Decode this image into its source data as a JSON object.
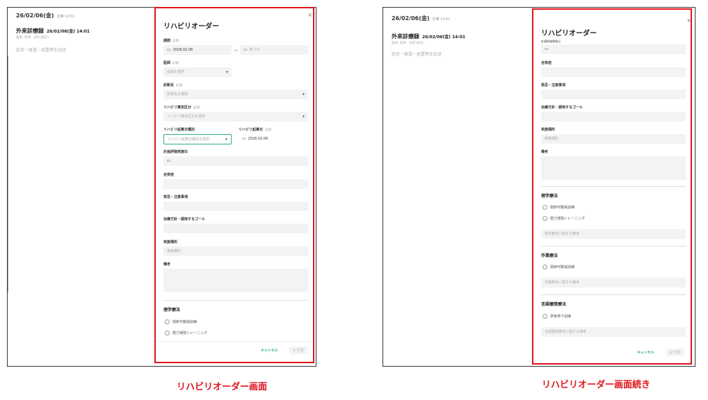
{
  "background": {
    "date_header": "26/02/06(金)",
    "date_sub": "診察 14:01",
    "record_title": "外来診療録",
    "record_datetime": "26/02/06(金) 14:01",
    "record_meta": "医師: 若林　初診(再診)",
    "note_placeholder": "症状・経過・処置等を記述"
  },
  "modal": {
    "title": "リハビリオーダー",
    "close": "×",
    "required": "必須",
    "period_label": "期間",
    "period_start": "2026.02.06",
    "period_tilde": "〜",
    "period_end_placeholder": "終了日",
    "doctor_label": "医師",
    "doctor_placeholder": "医師を選択",
    "diagnosis_label": "診断名",
    "diagnosis_placeholder": "診断名を選択",
    "calc_label": "リハビリ算定区分",
    "calc_placeholder": "リハビリ算定区分を選択",
    "start_type_label": "リハビリ起算日種別",
    "start_type_placeholder": "リハビリ起算日種別を選択",
    "start_date_label": "リハビリ起算日",
    "start_date_value": "2026.02.06",
    "plan_eval_label": "計画評価実施日",
    "complication_label": "合併症",
    "contraindication_label": "禁忌・注意事項",
    "goal_label": "治療方針・期待するゴール",
    "place_label": "実施場所",
    "place_placeholder": "実施場所",
    "remarks_label": "備考",
    "pt_section": "理学療法",
    "pt_option1": "関節可動域訓練",
    "pt_option2": "筋力増強トレーニング",
    "pt_note_placeholder": "理学療法に関する備考",
    "ot_section": "作業療法",
    "ot_option1": "関節可動域訓練",
    "ot_note_placeholder": "作業療法に関する備考",
    "st_section": "言語聴覚療法",
    "st_option1": "摂食嚥下訓練",
    "st_note_placeholder": "言語聴覚療法に関する備考",
    "cancel_button": "キャンセル",
    "create_button": "⊕ 作成",
    "cut_label": "計画評価実施日"
  },
  "captions": {
    "left": "リハビリオーダー画面",
    "right": "リハビリオーダー画面続き"
  },
  "colors": {
    "highlight": "#e0141e",
    "accent": "#2eaf7d"
  }
}
